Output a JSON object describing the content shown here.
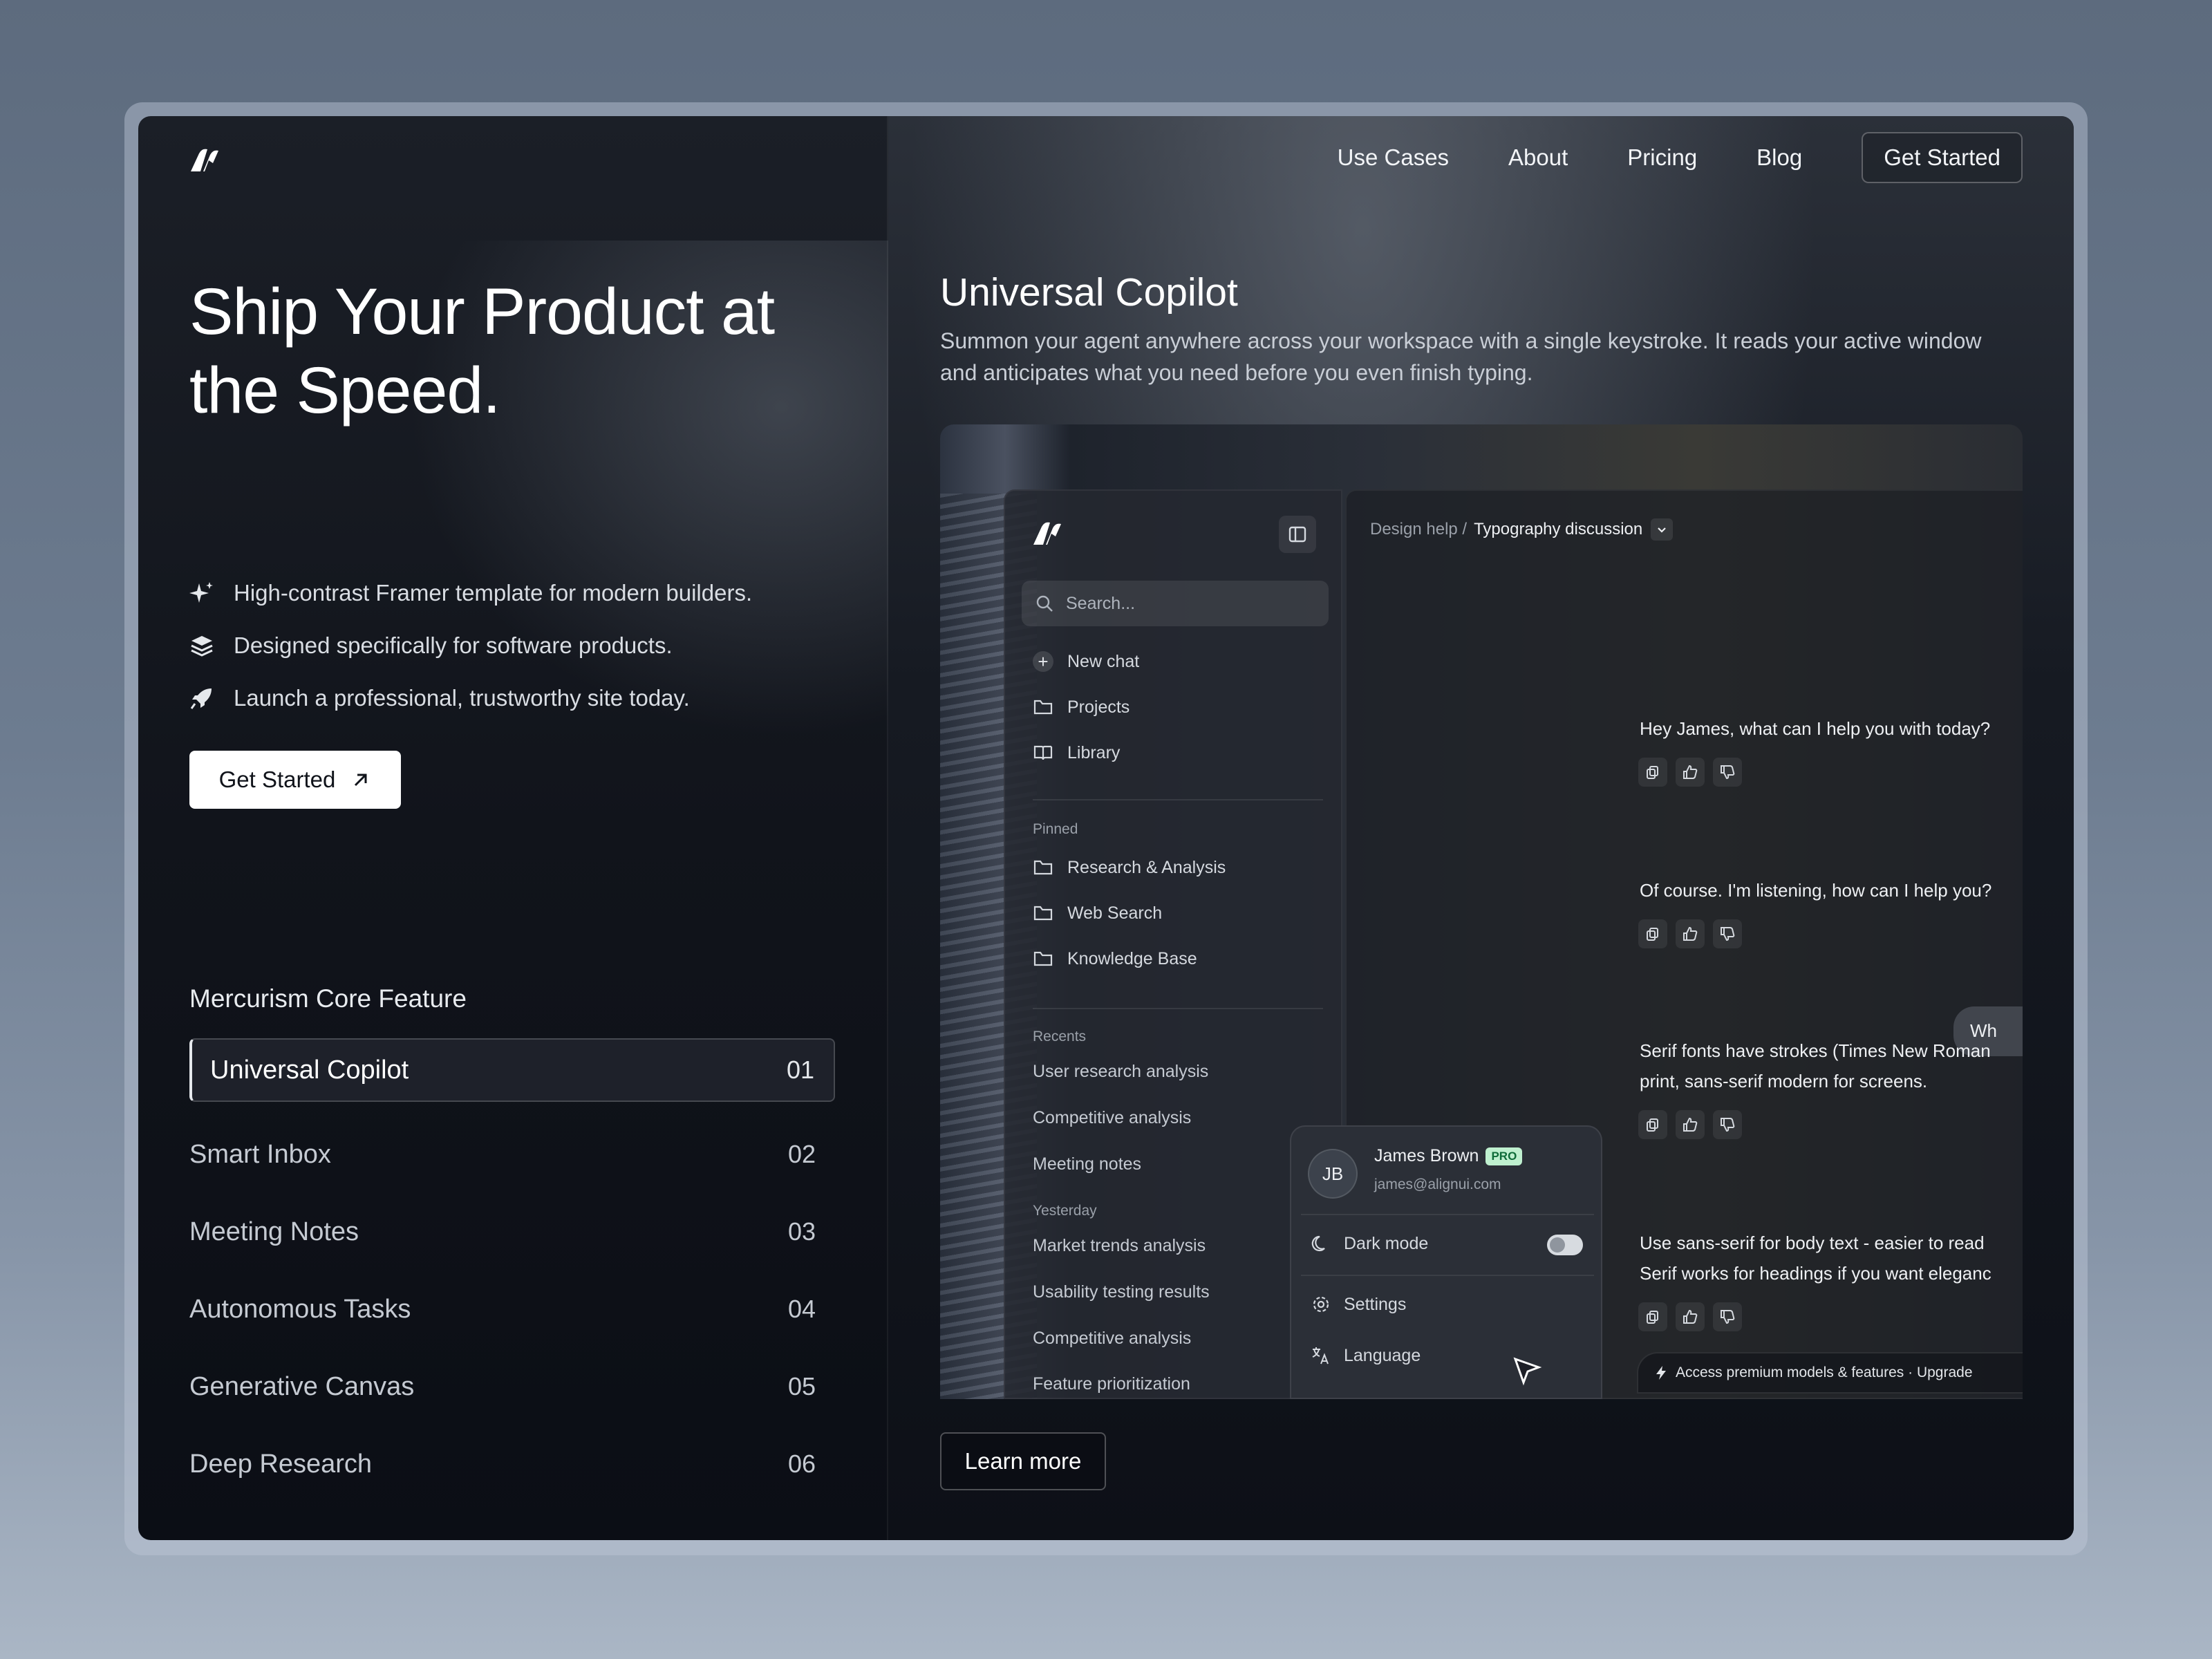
{
  "nav": {
    "links": [
      "Use Cases",
      "About",
      "Pricing",
      "Blog"
    ],
    "cta": "Get Started"
  },
  "hero": {
    "title": "Ship Your Product at the Speed.",
    "bullets": [
      {
        "icon": "sparkle-icon",
        "text": "High-contrast Framer template for modern builders."
      },
      {
        "icon": "layers-icon",
        "text": "Designed specifically for software products."
      },
      {
        "icon": "rocket-icon",
        "text": "Launch a professional, trustworthy site today."
      }
    ],
    "cta": "Get Started"
  },
  "features": {
    "title": "Mercurism Core Feature",
    "items": [
      {
        "label": "Universal Copilot",
        "num": "01",
        "active": true
      },
      {
        "label": "Smart Inbox",
        "num": "02"
      },
      {
        "label": "Meeting Notes",
        "num": "03"
      },
      {
        "label": "Autonomous Tasks",
        "num": "04"
      },
      {
        "label": "Generative Canvas",
        "num": "05"
      },
      {
        "label": "Deep Research",
        "num": "06"
      }
    ]
  },
  "section": {
    "title": "Universal Copilot",
    "description": "Summon your agent anywhere across your workspace with a single keystroke. It reads your active window and anticipates what you need before you even finish typing.",
    "learn_more": "Learn more"
  },
  "mock": {
    "search_placeholder": "Search...",
    "nav": [
      "New chat",
      "Projects",
      "Library"
    ],
    "pinned_label": "Pinned",
    "pinned": [
      "Research & Analysis",
      "Web Search",
      "Knowledge Base"
    ],
    "recents_label": "Recents",
    "recents": [
      "User research analysis",
      "Competitive analysis",
      "Meeting notes"
    ],
    "yesterday_label": "Yesterday",
    "yesterday": [
      "Market trends analysis",
      "Usability testing results",
      "Competitive analysis",
      "Feature prioritization"
    ],
    "breadcrumb": {
      "parent": "Design help /",
      "current": "Typography discussion"
    },
    "messages": [
      "Hey James, what can I help you with today?",
      "Of course. I'm listening, how can I help you?",
      "Serif fonts have strokes (Times New Roman",
      "print, sans-serif modern for screens.",
      "Use sans-serif for body text - easier to read",
      "Serif works for headings if you want eleganc"
    ],
    "user_bubble": "Wh",
    "upgrade": "Access premium models & features · Upgrade",
    "user": {
      "initials": "JB",
      "name": "James Brown",
      "badge": "PRO",
      "email": "james@alignui.com",
      "menu": [
        "Dark mode",
        "Settings",
        "Language"
      ]
    }
  }
}
